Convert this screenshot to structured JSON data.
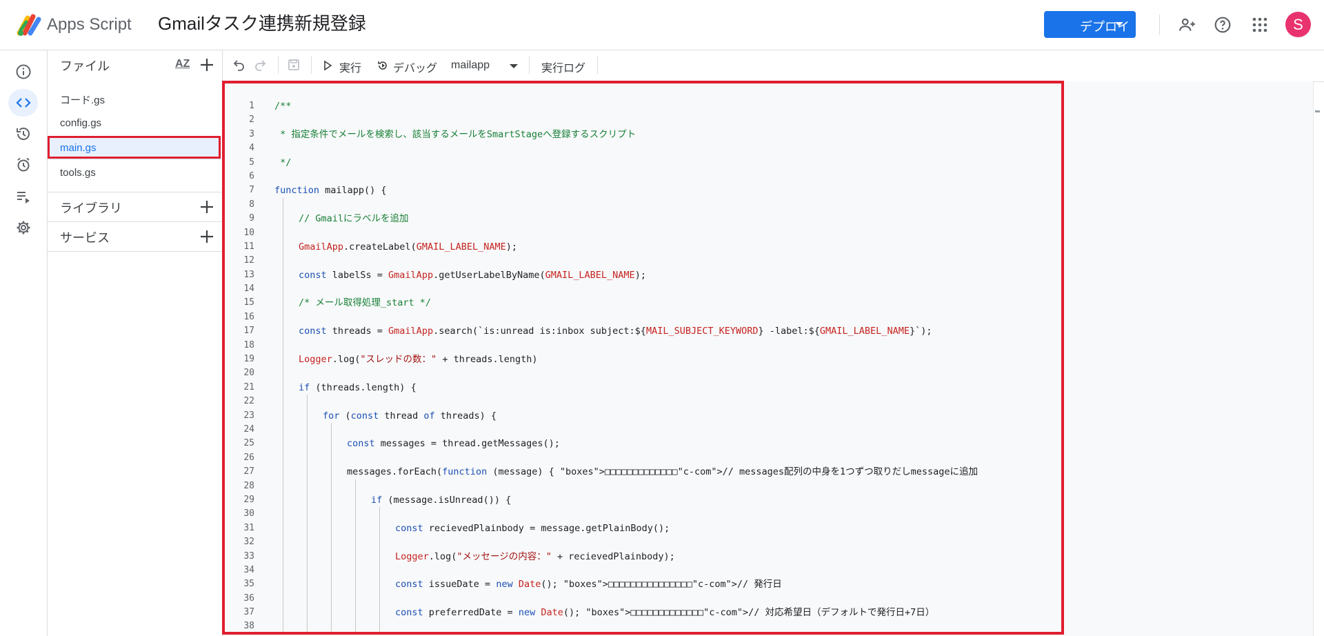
{
  "header": {
    "app_name": "Apps Script",
    "project_title": "Gmailタスク連携新規登録",
    "deploy_label": "デプロイ",
    "avatar_letter": "S"
  },
  "files": {
    "header": "ファイル",
    "sort_label": "AZ",
    "items": [
      "コード.gs",
      "config.gs",
      "main.gs",
      "tools.gs"
    ],
    "selected": "main.gs",
    "libraries_label": "ライブラリ",
    "services_label": "サービス"
  },
  "toolbar": {
    "run_label": "実行",
    "debug_label": "デバッグ",
    "function_select": "mailapp",
    "log_label": "実行ログ"
  },
  "code_lines": [
    "/**",
    "",
    " * 指定条件でメールを検索し、該当するメールをSmartStageへ登録するスクリプト",
    "",
    " */",
    "",
    "function mailapp() {",
    "",
    "// Gmailにラベルを追加",
    "",
    "GmailApp.createLabel(GMAIL_LABEL_NAME);",
    "",
    "const labelSs = GmailApp.getUserLabelByName(GMAIL_LABEL_NAME);",
    "",
    "/* メール取得処理_start */",
    "",
    "const threads = GmailApp.search(`is:unread is:inbox subject:${MAIL_SUBJECT_KEYWORD} -label:${GMAIL_LABEL_NAME}`);",
    "",
    "Logger.log(\"スレッドの数：\" + threads.length)",
    "",
    "if (threads.length) {",
    "",
    "for (const thread of threads) {",
    "",
    "const messages = thread.getMessages();",
    "",
    "messages.forEach(function (message) { □□□□□□□□□□□□□// messages配列の中身を1つずつ取りだしmessageに追加",
    "",
    "if (message.isUnread()) {",
    "",
    "const recievedPlainbody = message.getPlainBody();",
    "",
    "Logger.log(\"メッセージの内容：\" + recievedPlainbody);",
    "",
    "const issueDate = new Date(); □□□□□□□□□□□□□□□// 発行日",
    "",
    "const preferredDate = new Date(); □□□□□□□□□□□□□// 対応希望日（デフォルトで発行日+7日）",
    ""
  ]
}
